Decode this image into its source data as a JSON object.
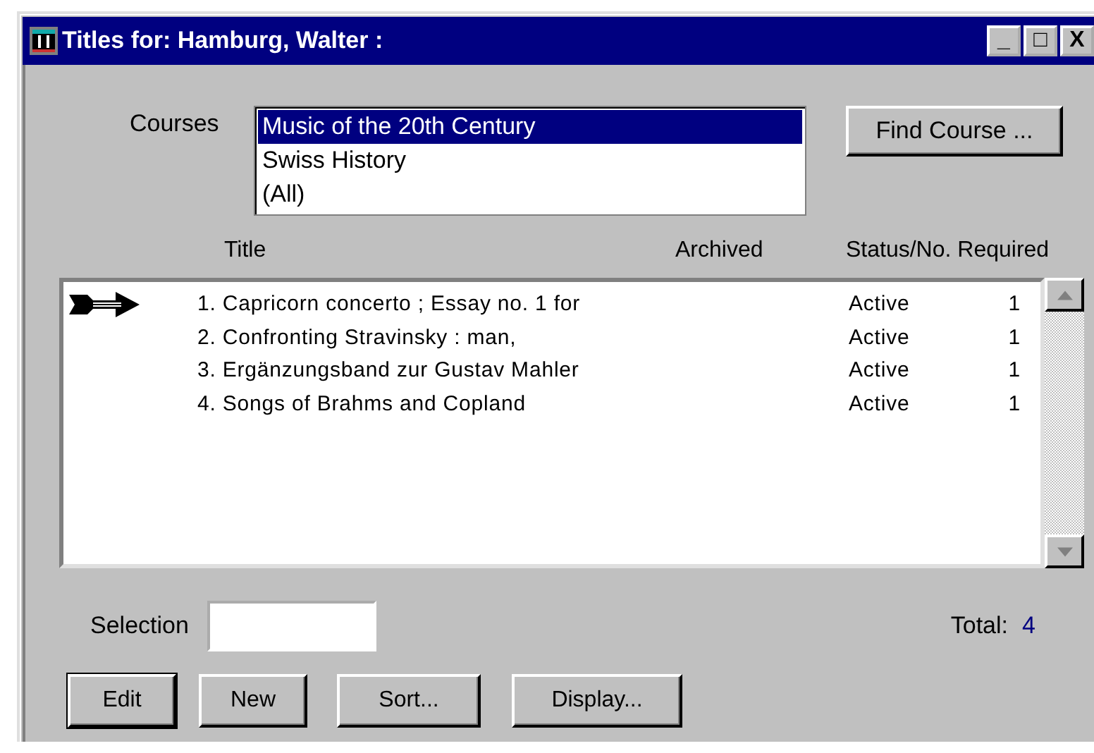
{
  "window": {
    "title": "Titles for: Hamburg, Walter :",
    "controls": [
      "_",
      "□",
      "X"
    ]
  },
  "courses": {
    "label": "Courses",
    "items": [
      {
        "label": "Music of the 20th Century",
        "selected": true
      },
      {
        "label": "Swiss History",
        "selected": false
      },
      {
        "label": "(All)",
        "selected": false
      }
    ]
  },
  "find_button": "Find Course ...",
  "table": {
    "columns": [
      "Title",
      "Archived",
      "Status/No. Required"
    ],
    "rows": [
      {
        "title": "1. Capricorn concerto ; Essay no. 1 for",
        "status": "Active",
        "required": "1",
        "current": true
      },
      {
        "title": "2. Confronting Stravinsky : man,",
        "status": "Active",
        "required": "1",
        "current": false
      },
      {
        "title": "3. Ergänzungsband zur Gustav Mahler",
        "status": "Active",
        "required": "1",
        "current": false
      },
      {
        "title": "4. Songs of Brahms and Copland",
        "status": "Active",
        "required": "1",
        "current": false
      }
    ]
  },
  "selection": {
    "label": "Selection"
  },
  "total": {
    "label": "Total:",
    "value": "4"
  },
  "buttons": [
    {
      "label": "Edit",
      "default": true
    },
    {
      "label": "New",
      "default": false
    },
    {
      "label": "Sort...",
      "default": false
    },
    {
      "label": "Display...",
      "default": false
    }
  ]
}
